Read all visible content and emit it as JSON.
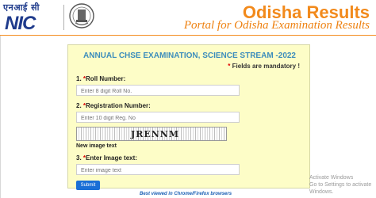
{
  "header": {
    "nic_hindi": "एनआई सी",
    "nic_text": "NIC",
    "title": "Odisha Results",
    "subtitle": "Portal for Odisha Examination Results"
  },
  "form": {
    "exam_title": "ANNUAL CHSE EXAMINATION, SCIENCE STREAM -2022",
    "mandatory_note": "Fields are mandatory !",
    "roll_label": "1. ",
    "roll_label_text": "Roll Number:",
    "roll_placeholder": "Enter 8 digit Roll No.",
    "reg_label": "2. ",
    "reg_label_text": "Registration Number:",
    "reg_placeholder": "Enter 10 digit Reg. No",
    "captcha_text": "JRENNM",
    "new_image_text": "New image text",
    "image_label": "3. ",
    "image_label_text": "Enter Image text:",
    "image_placeholder": "Enter image text",
    "submit_label": "Submit"
  },
  "footer": {
    "best_viewed": "Best viewed in Chrome/Firefox browsers",
    "activate_line1": "Activate Windows",
    "activate_line2": "Go to Settings to activate Windows."
  },
  "colors": {
    "brand_orange": "#f28a1c",
    "panel_yellow": "#fdfdc7",
    "title_blue": "#3c8dbc",
    "submit_blue": "#1a6fd6"
  }
}
